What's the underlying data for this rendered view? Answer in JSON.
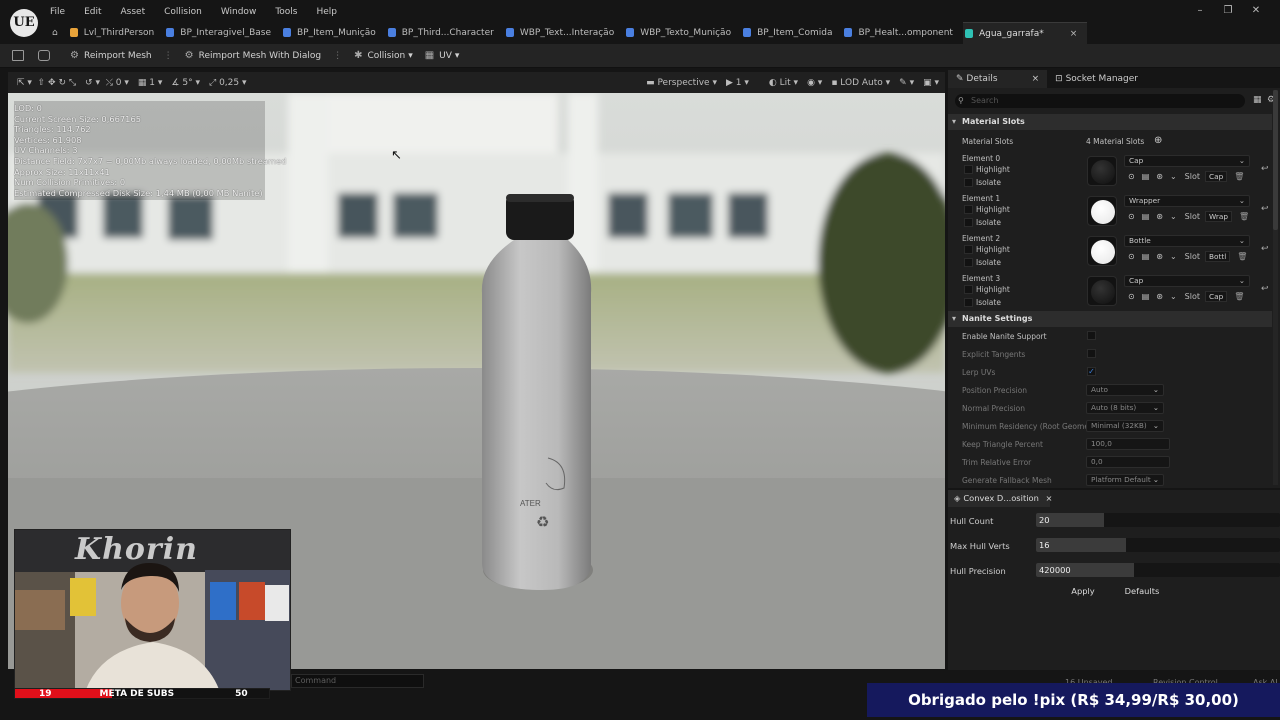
{
  "app": {
    "logo": "UE",
    "menu": [
      "File",
      "Edit",
      "Asset",
      "Collision",
      "Window",
      "Tools",
      "Help"
    ],
    "tabs": [
      {
        "label": "Lvl_ThirdPerson",
        "color": "#e8a33a"
      },
      {
        "label": "BP_Interagivel_Base",
        "color": "#4a7fe0"
      },
      {
        "label": "BP_Item_Munição",
        "color": "#4a7fe0"
      },
      {
        "label": "BP_Third...Character",
        "color": "#4a7fe0"
      },
      {
        "label": "WBP_Text...Interação",
        "color": "#4a7fe0"
      },
      {
        "label": "WBP_Texto_Munição",
        "color": "#4a7fe0"
      },
      {
        "label": "BP_Item_Comida",
        "color": "#4a7fe0"
      },
      {
        "label": "BP_Healt...omponent",
        "color": "#4a7fe0"
      },
      {
        "label": "Agua_garrafa*",
        "color": "#2fc2b5",
        "active": true,
        "close": "×"
      }
    ],
    "window_controls": [
      "–",
      "❐",
      "✕"
    ]
  },
  "toolbar": {
    "reimport": "Reimport Mesh",
    "reimport_dialog": "Reimport Mesh With Dialog",
    "collision": "Collision",
    "uv": "UV"
  },
  "viewport_toolbar": {
    "rot": "0",
    "grid": "1",
    "angle": "5°",
    "scale": "0,25",
    "perspective": "Perspective",
    "cam": "1",
    "lit": "Lit",
    "lod": "LOD Auto"
  },
  "stats": [
    "LOD: 0",
    "Current Screen Size: 0,667165",
    "Triangles: 114.762",
    "Vertices: 61.908",
    "UV Channels: 3",
    "Distance Field: 7x7x7 = 0,00Mb always loaded, 0,00Mb streamed",
    "Approx Size: 11x11x41",
    "Num Collision Primitives: 0",
    "Estimated Compressed Disk Size: 1,44 MB (0,00 MB Nanite)"
  ],
  "webcam": {
    "banner_text": "Khorin"
  },
  "subs": {
    "current": "19",
    "label": "META DE SUBS",
    "goal": "50",
    "progress": 0.38
  },
  "command": {
    "placeholder": "Command"
  },
  "pix_banner": "Obrigado pelo !pix (R$ 34,99/R$ 30,00)",
  "details": {
    "tab": "Details",
    "tab_close": "×",
    "tab2": "Socket Manager",
    "search_placeholder": "Search",
    "material_section": "Material Slots",
    "material_slots_label": "Material Slots",
    "material_slots_value": "4 Material Slots",
    "elements": [
      {
        "name": "Element 0",
        "material": "Cap",
        "slot": "Cap",
        "sphere": "#0f0f0f"
      },
      {
        "name": "Element 1",
        "material": "Wrapper",
        "slot": "Wrap",
        "sphere": "#e6e6e6"
      },
      {
        "name": "Element 2",
        "material": "Bottle",
        "slot": "Bottl",
        "sphere": "#e6e6e6"
      },
      {
        "name": "Element 3",
        "material": "Cap",
        "slot": "Cap",
        "sphere": "#0f0f0f"
      }
    ],
    "highlight": "Highlight",
    "isolate": "Isolate",
    "slot_label": "Slot",
    "nanite_section": "Nanite Settings",
    "nanite": [
      {
        "label": "Enable Nanite Support",
        "type": "check",
        "checked": false,
        "dim": false
      },
      {
        "label": "Explicit Tangents",
        "type": "check",
        "checked": false,
        "dim": true
      },
      {
        "label": "Lerp UVs",
        "type": "check",
        "checked": true,
        "dim": true
      },
      {
        "label": "Position Precision",
        "type": "dd",
        "value": "Auto",
        "dim": true
      },
      {
        "label": "Normal Precision",
        "type": "dd",
        "value": "Auto (8 bits)",
        "dim": true
      },
      {
        "label": "Minimum Residency (Root Geome",
        "type": "dd",
        "value": "Minimal (32KB)",
        "dim": true
      },
      {
        "label": "Keep Triangle Percent",
        "type": "num",
        "value": "100,0",
        "dim": true
      },
      {
        "label": "Trim Relative Error",
        "type": "num",
        "value": "0,0",
        "dim": true
      },
      {
        "label": "Generate Fallback Mesh",
        "type": "dd",
        "value": "Platform Default",
        "dim": true
      }
    ]
  },
  "convex": {
    "tab": "Convex D...osition",
    "close": "×",
    "fields": [
      {
        "label": "Hull Count",
        "value": "20",
        "fill": 0.28
      },
      {
        "label": "Max Hull Verts",
        "value": "16",
        "fill": 0.37
      },
      {
        "label": "Hull Precision",
        "value": "420000",
        "fill": 0.4
      }
    ],
    "apply": "Apply",
    "defaults": "Defaults"
  },
  "statusbar": {
    "unsaved": "16 Unsaved",
    "revision": "Revision Control",
    "ask": "Ask AI"
  }
}
